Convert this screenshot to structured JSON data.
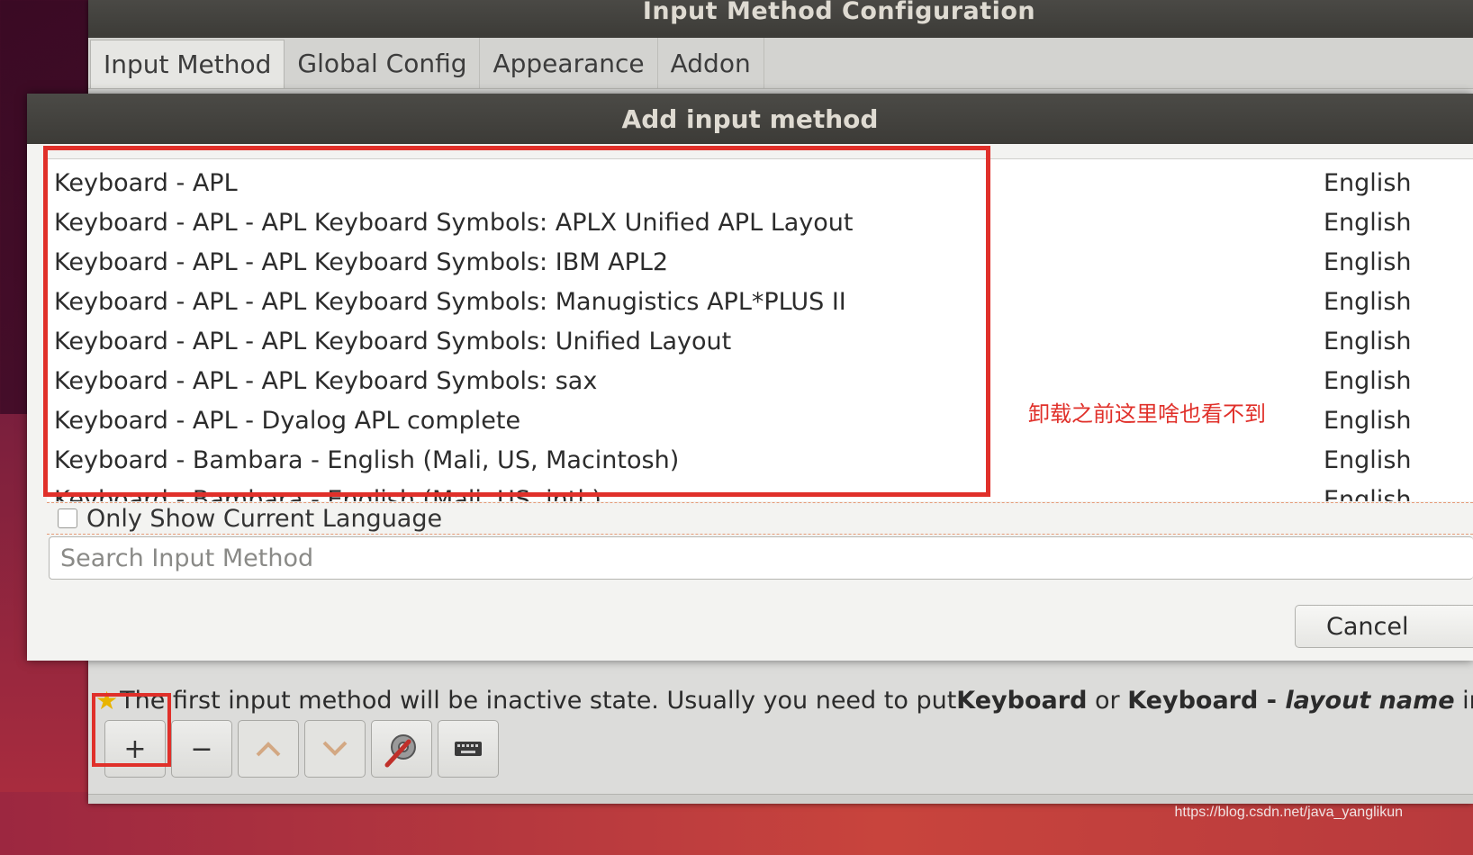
{
  "main_window": {
    "title": "Input Method Configuration",
    "tabs": [
      {
        "label": "Input Method"
      },
      {
        "label": "Global Config"
      },
      {
        "label": "Appearance"
      },
      {
        "label": "Addon"
      }
    ],
    "hint": {
      "prefix": "The first input method will be inactive state. Usually you need to put ",
      "keyboard": "Keyboard",
      "or": " or ",
      "keyboard_layout_prefix": "Keyboard - ",
      "layout_name": "layout name",
      "suffix": " in the"
    },
    "toolbar": {
      "add_label": "+",
      "remove_label": "−",
      "up_label": "︿",
      "down_label": "﹀",
      "configure_icon": "wrench-gear-icon",
      "keyboard_icon": "keyboard-icon"
    }
  },
  "dialog": {
    "title": "Add input method",
    "rows": [
      {
        "name": "Keyboard - APL",
        "lang": "English"
      },
      {
        "name": "Keyboard - APL - APL Keyboard Symbols: APLX Unified APL Layout",
        "lang": "English"
      },
      {
        "name": "Keyboard - APL - APL Keyboard Symbols: IBM APL2",
        "lang": "English"
      },
      {
        "name": "Keyboard - APL - APL Keyboard Symbols: Manugistics APL*PLUS II",
        "lang": "English"
      },
      {
        "name": "Keyboard - APL - APL Keyboard Symbols: Unified Layout",
        "lang": "English"
      },
      {
        "name": "Keyboard - APL - APL Keyboard Symbols: sax",
        "lang": "English"
      },
      {
        "name": "Keyboard - APL - Dyalog APL complete",
        "lang": "English"
      },
      {
        "name": "Keyboard - Bambara - English (Mali, US, Macintosh)",
        "lang": "English"
      },
      {
        "name": "Keyboard - Bambara - English (Mali, US, intl.)",
        "lang": "English"
      }
    ],
    "only_show_current_language": "Only Show Current Language",
    "search_placeholder": "Search Input Method",
    "cancel_label": "Cancel"
  },
  "annotation": "卸载之前这里啥也看不到",
  "watermark": "https://blog.csdn.net/java_yanglikun",
  "colors": {
    "highlight": "#e0302a",
    "titlebar": "#3c3b37"
  }
}
